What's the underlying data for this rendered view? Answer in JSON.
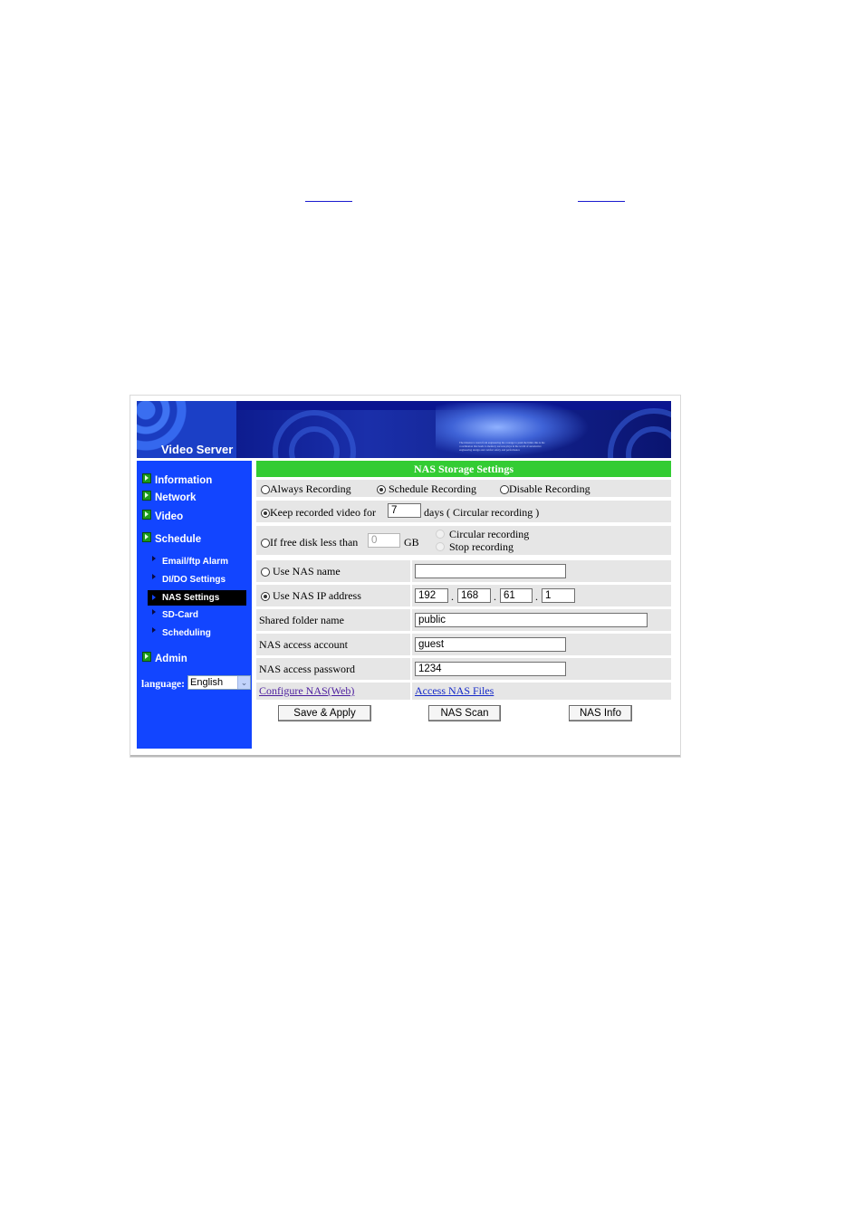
{
  "window": {
    "banner_title": "Video Server",
    "banner_fineprint": "The mission to learn from engineering the courage to push the limits this is the coordination that leads to memory success plays in the world of automotive engineering design and comfort safety and performance"
  },
  "sidebar": {
    "menu": [
      {
        "label": "Information"
      },
      {
        "label": "Network"
      },
      {
        "label": "Video"
      },
      {
        "label": "Schedule"
      }
    ],
    "submenu": [
      {
        "label": "Email/ftp Alarm"
      },
      {
        "label": "DI/DO Settings"
      },
      {
        "label": "NAS Settings",
        "active": true
      },
      {
        "label": "SD-Card"
      },
      {
        "label": "Scheduling"
      }
    ],
    "admin": {
      "label": "Admin"
    },
    "language_label": "language:",
    "language_value": "English"
  },
  "nas": {
    "header": "NAS Storage Settings",
    "mode": {
      "options": [
        "Always Recording",
        "Schedule Recording",
        "Disable Recording"
      ],
      "selected": "Schedule Recording"
    },
    "keep": {
      "label": "Keep recorded video for",
      "days_value": "7",
      "suffix": "days ( Circular recording )"
    },
    "free_disk": {
      "label": "If free disk less than",
      "gb_value": "0",
      "unit": "GB",
      "option_circular": "Circular recording",
      "option_stop": "Stop recording"
    },
    "use_nas_name": {
      "label": "Use NAS name",
      "value": ""
    },
    "use_nas_ip": {
      "label": "Use NAS IP address",
      "ip": [
        "192",
        "168",
        "61",
        "1"
      ],
      "dot": "."
    },
    "shared_folder": {
      "label": "Shared folder name",
      "value": "public"
    },
    "account": {
      "label": "NAS access account",
      "value": "guest"
    },
    "password": {
      "label": "NAS access password",
      "value": "1234"
    },
    "links": {
      "configure": "Configure NAS(Web)",
      "access": "Access NAS Files"
    },
    "buttons": {
      "save": "Save & Apply",
      "scan": "NAS Scan",
      "info": "NAS Info"
    }
  },
  "colors": {
    "sidebar_bg": "#1245ff",
    "header_green": "#33cc33",
    "row_gray": "#e6e6e6"
  }
}
